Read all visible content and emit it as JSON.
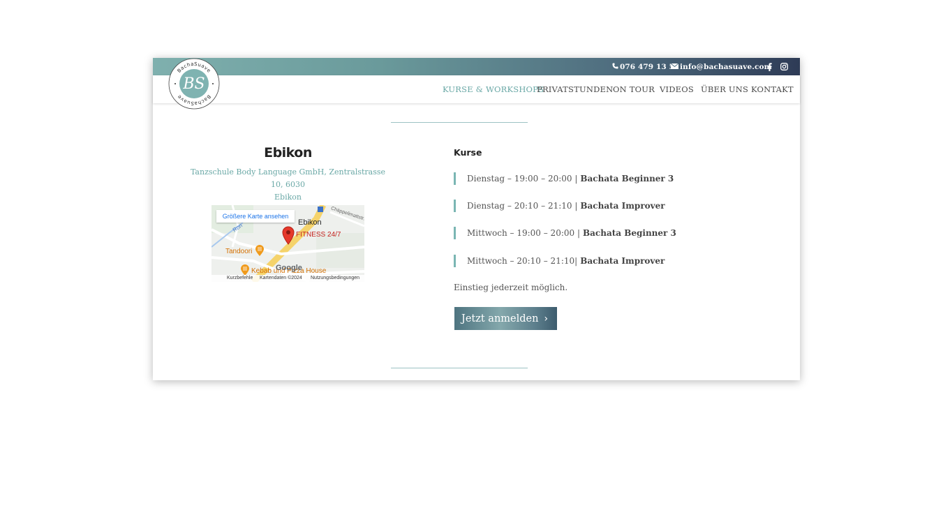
{
  "topbar": {
    "phone": "076 479 13 51",
    "email": "info@bachasuave.com",
    "facebook_icon": "facebook-icon",
    "instagram_icon": "instagram-icon"
  },
  "logo": {
    "text_top": "BachaSuave",
    "text_bottom": "BachaSuave",
    "monogram": "BS"
  },
  "nav": {
    "items": [
      {
        "label": "KURSE & WORKSHOPS",
        "active": true
      },
      {
        "label": "PRIVATSTUNDEN"
      },
      {
        "label": "ON TOUR"
      },
      {
        "label": "VIDEOS"
      },
      {
        "label": "ÜBER UNS"
      },
      {
        "label": "KONTAKT"
      }
    ]
  },
  "location": {
    "title": "Ebikon",
    "address_line1": "Tanzschule Body Language GmbH, Zentralstrasse 10, 6030",
    "address_line2": "Ebikon"
  },
  "map": {
    "larger_map_link": "Größere Karte ansehen",
    "city_label": "Ebikon",
    "place_fitness": "FITNESS 24/7",
    "place_tandoori": "Tandoori",
    "place_kebab": "Kebab und Pizza House",
    "street_label": "Chäppelimattstr.",
    "road_label": "Ron",
    "google": "Google",
    "footer_shortcuts": "Kurzbefehle",
    "footer_data": "Kartendaten ©2024",
    "footer_terms": "Nutzungsbedingungen"
  },
  "courses": {
    "title": "Kurse",
    "items": [
      {
        "time": "Dienstag – 19:00 – 20:00 |",
        "name": "Bachata Beginner 3"
      },
      {
        "time": "Dienstag – 20:10 – 21:10 |",
        "name": "Bachata Improver"
      },
      {
        "time": "Mittwoch – 19:00 – 20:00 |",
        "name": "Bachata Beginner 3"
      },
      {
        "time": "Mittwoch – 20:10 – 21:10|",
        "name": "Bachata Improver"
      }
    ],
    "note": "Einstieg jederzeit  möglich.",
    "cta_label": "Jetzt anmelden"
  },
  "colors": {
    "accent": "#6aa8a6",
    "topbar_start": "#7fb0ae",
    "topbar_end": "#2e3b56"
  }
}
